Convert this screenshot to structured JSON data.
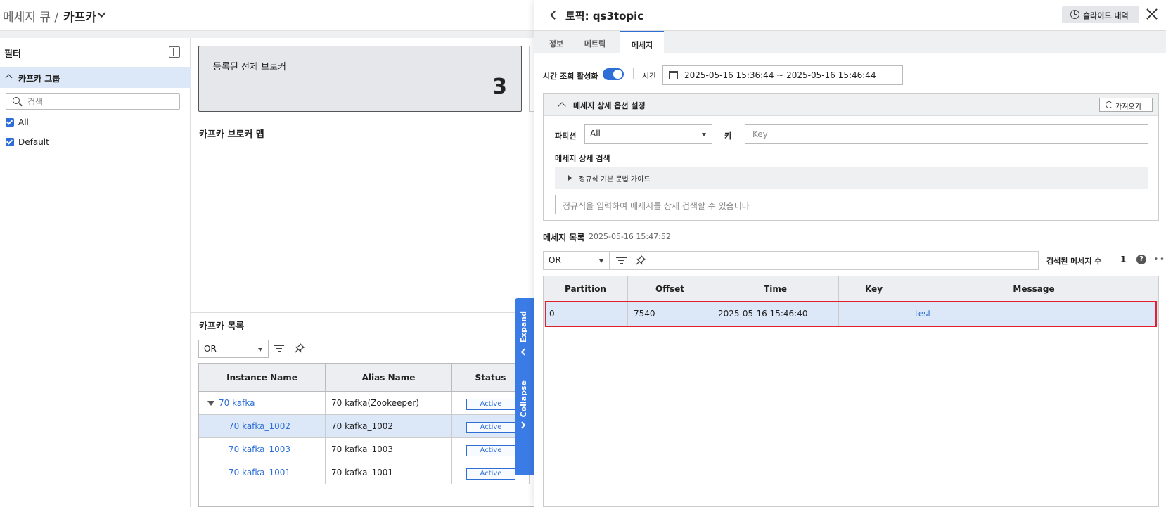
{
  "header": {
    "breadcrumb": "메세지 큐 /",
    "current": "카프카"
  },
  "sidebar": {
    "title": "필터",
    "group": "카프카 그룹",
    "search_placeholder": "검색",
    "items": [
      {
        "label": "All",
        "checked": true
      },
      {
        "label": "Default",
        "checked": true
      }
    ]
  },
  "summary": {
    "label": "등록된 전체 브로커",
    "value": "3"
  },
  "broker_map": {
    "title": "카프카 브로커 맵"
  },
  "kafka_list": {
    "title": "카프카 목록",
    "filter_mode": "OR",
    "columns": [
      "Instance Name",
      "Alias Name",
      "Status"
    ],
    "rows": [
      {
        "instance": "70 kafka",
        "alias": "70 kafka(Zookeeper)",
        "status": "Active",
        "expanded": true,
        "selected": false
      },
      {
        "instance": "70 kafka_1002",
        "alias": "70 kafka_1002",
        "status": "Active",
        "selected": true
      },
      {
        "instance": "70 kafka_1003",
        "alias": "70 kafka_1003",
        "status": "Active",
        "selected": false
      },
      {
        "instance": "70 kafka_1001",
        "alias": "70 kafka_1001",
        "status": "Active",
        "selected": false
      }
    ]
  },
  "side_tabs": {
    "expand": "Expand",
    "collapse": "Collapse"
  },
  "panel": {
    "title": "토픽: qs3topic",
    "history_button": "슬라이드 내역",
    "tabs": [
      "정보",
      "메트릭",
      "메세지"
    ],
    "active_tab": "메세지",
    "time_toggle_label": "시간 조회 활성화",
    "time_toggle_on": true,
    "time_label": "시간",
    "time_range": "2025-05-16 15:36:44 ~ 2025-05-16 15:46:44",
    "options": {
      "title": "메세지 상세 옵션 설정",
      "fetch_button": "가져오기",
      "partition_label": "파티션",
      "partition_value": "All",
      "key_label": "키",
      "key_placeholder": "Key",
      "detail_search_label": "메세지 상세 검색",
      "guide_label": "정규식 기본 문법 가이드",
      "regex_placeholder": "정규식을 입력하여 메세지를 상세 검색할 수 있습니다"
    },
    "message_list": {
      "title": "메세지 목록",
      "timestamp": "2025-05-16 15:47:52",
      "filter_mode": "OR",
      "count_label": "검색된 메세지 수",
      "count": "1",
      "columns": [
        "Partition",
        "Offset",
        "Time",
        "Key",
        "Message"
      ],
      "rows": [
        {
          "partition": "0",
          "offset": "7540",
          "time": "2025-05-16 15:46:40",
          "key": "",
          "message": "test"
        }
      ]
    }
  },
  "colors": {
    "accent": "#2d6fd6",
    "highlight": "#e0202a",
    "selected_row": "#dce8f7"
  }
}
